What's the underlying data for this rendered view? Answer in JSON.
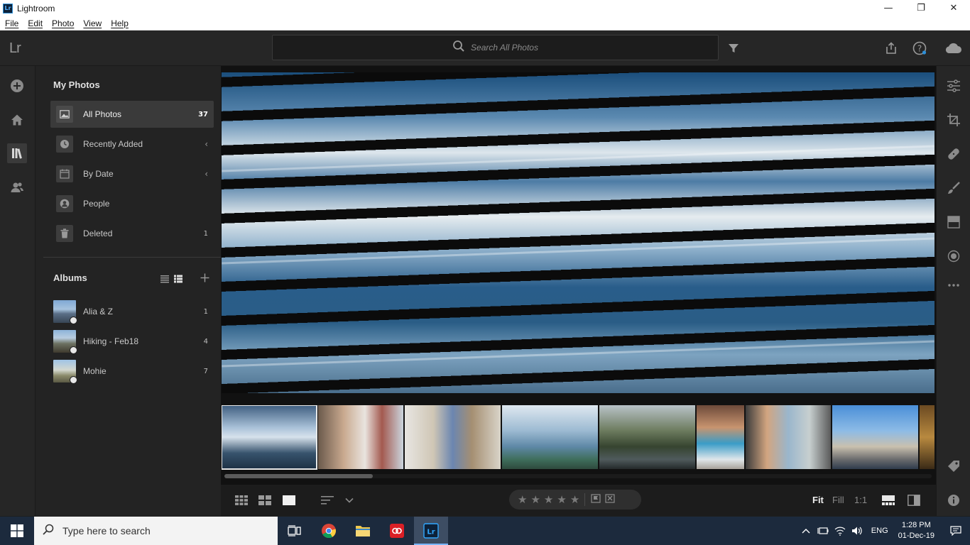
{
  "window": {
    "app_badge": "Lr",
    "title": "Lightroom",
    "controls": {
      "minimize": "—",
      "maximize": "❐",
      "close": "✕"
    }
  },
  "menu": [
    "File",
    "Edit",
    "Photo",
    "View",
    "Help"
  ],
  "toolbar": {
    "logo": "Lr",
    "search_placeholder": "Search All Photos"
  },
  "left_panel": {
    "my_photos_title": "My Photos",
    "nav": [
      {
        "label": "All Photos",
        "count": "37"
      },
      {
        "label": "Recently Added",
        "chevron": "‹"
      },
      {
        "label": "By Date",
        "chevron": "‹"
      },
      {
        "label": "People"
      },
      {
        "label": "Deleted",
        "count": "1"
      }
    ],
    "albums_title": "Albums",
    "albums": [
      {
        "label": "Alia & Z",
        "count": "1"
      },
      {
        "label": "Hiking - Feb18",
        "count": "4"
      },
      {
        "label": "Mohie",
        "count": "7"
      }
    ]
  },
  "bottom_bar": {
    "stars": [
      "★",
      "★",
      "★",
      "★",
      "★"
    ],
    "zoom": {
      "fit": "Fit",
      "fill": "Fill",
      "one_to_one": "1:1"
    }
  },
  "filmstrip": {
    "selected_index": 0,
    "scroll_fraction": 0.21
  },
  "taskbar": {
    "search_placeholder": "Type here to search",
    "language": "ENG",
    "time": "1:28 PM",
    "date": "01-Dec-19"
  }
}
